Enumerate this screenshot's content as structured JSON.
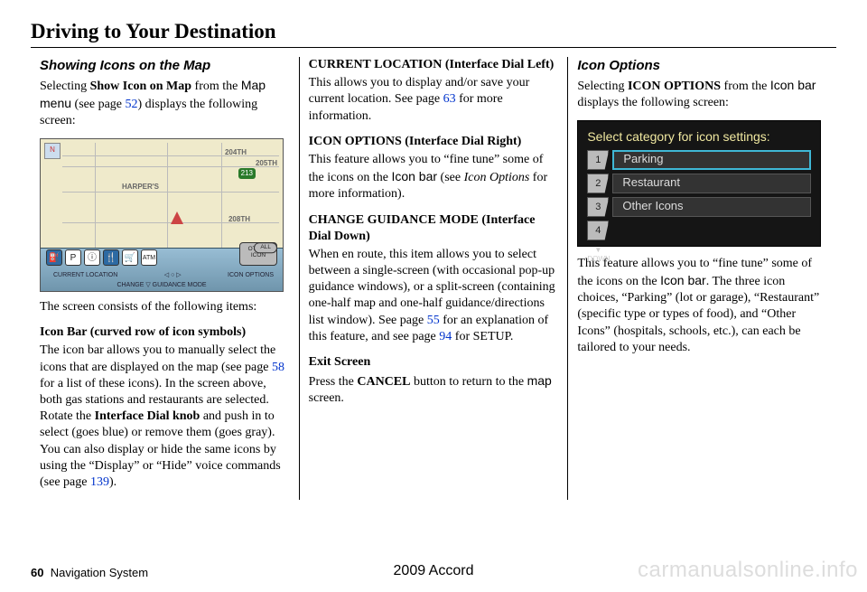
{
  "header": {
    "title": "Driving to Your Destination"
  },
  "col1": {
    "heading": "Showing Icons on the Map",
    "p1_a": "Selecting ",
    "p1_bold": "Show Icon on Map",
    "p1_b": " from the ",
    "p1_sans": "Map menu",
    "p1_c": " (see page ",
    "p1_link": "52",
    "p1_d": ") displays the following screen:",
    "map": {
      "compass": "N",
      "streets": {
        "a": "HARPER'S",
        "b": "204TH",
        "c": "205TH",
        "d": "208TH"
      },
      "shield": "213",
      "icons": [
        "⛽",
        "P",
        "ⓘ",
        "🍴",
        "🛒",
        "ATM"
      ],
      "other": "OTHER ICON",
      "all": "ALL",
      "tray1a": "CURRENT LOCATION",
      "tray1b": "ICON OPTIONS",
      "tray2": "CHANGE ▽ GUIDANCE MODE"
    },
    "p2": "The screen consists of the following items:",
    "p3_head": "Icon Bar (curved row of icon symbols)",
    "p3_a": "The icon bar allows you to manually select the icons that are displayed on the map (see page ",
    "p3_link1": "58",
    "p3_b": " for a list of these icons). In the screen above, both gas stations and restaurants are selected. Rotate the ",
    "p3_bold": "Interface Dial knob",
    "p3_c": " and push in to select (goes blue) or remove them (goes gray). You can also display or hide the same icons by using the “Display” or “Hide” voice commands (see page ",
    "p3_link2": "139",
    "p3_d": ")."
  },
  "col2": {
    "h1": "CURRENT LOCATION (Interface Dial Left)",
    "p1_a": "This allows you to display and/or save your current location. See page ",
    "p1_link": "63",
    "p1_b": " for more information.",
    "h2": "ICON OPTIONS (Interface Dial Right)",
    "p2_a": "This feature allows you to “fine tune” some of the icons on the ",
    "p2_sans": "Icon bar",
    "p2_b": " (see ",
    "p2_ital": "Icon Options",
    "p2_c": " for more information).",
    "h3": "CHANGE GUIDANCE MODE (Interface Dial Down)",
    "p3_a": "When en route, this item allows you to select between a single-screen (with occasional pop-up guidance windows), or a split-screen (containing one-half map and one-half guidance/directions list window). See page ",
    "p3_link1": "55",
    "p3_b": " for an explanation of this feature, and see page ",
    "p3_link2": "94",
    "p3_c": " for SETUP.",
    "h4": "Exit Screen",
    "p4_a": "Press the ",
    "p4_bold": "CANCEL",
    "p4_b": " button to return to the ",
    "p4_sans": "map",
    "p4_c": " screen."
  },
  "col3": {
    "heading": "Icon Options",
    "p1_a": "Selecting ",
    "p1_bold": "ICON OPTIONS",
    "p1_b": " from the ",
    "p1_sans": "Icon bar",
    "p1_c": " displays the following screen:",
    "shot": {
      "title": "Select category for icon settings:",
      "nums": [
        "1",
        "2",
        "3",
        "4"
      ],
      "down": "DOWN",
      "opts": [
        "Parking",
        "Restaurant",
        "Other Icons"
      ]
    },
    "p2_a": "This feature allows you to “fine tune” some of the icons on the ",
    "p2_sans": "Icon bar",
    "p2_b": ". The three icon choices, “Parking” (lot or garage), “Restaurant” (specific type or types of food), and “Other Icons” (hospitals, schools, etc.), can each be tailored to your needs."
  },
  "footer": {
    "page": "60",
    "section": "Navigation System",
    "model": "2009  Accord"
  },
  "watermark": "carmanualsonline.info"
}
